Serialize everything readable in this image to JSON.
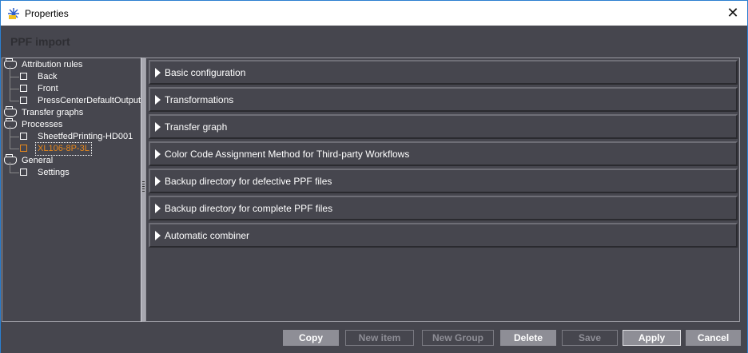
{
  "window": {
    "title": "Properties",
    "close_icon": "close-icon"
  },
  "header": {
    "title": "PPF import"
  },
  "tree": {
    "groups": [
      {
        "label": "Attribution rules",
        "items": [
          "Back",
          "Front",
          "PressCenterDefaultOutput"
        ]
      },
      {
        "label": "Transfer graphs",
        "items": []
      },
      {
        "label": "Processes",
        "items": [
          "SheetfedPrinting-HD001",
          "XL106-8P-3L"
        ]
      },
      {
        "label": "General",
        "items": [
          "Settings"
        ]
      }
    ],
    "selected": "XL106-8P-3L",
    "selected_color": "#e8881c"
  },
  "sections": [
    "Basic configuration",
    "Transformations",
    "Transfer graph",
    "Color Code Assignment Method for Third-party Workflows",
    "Backup directory for defective PPF files",
    "Backup directory for complete PPF files",
    "Automatic combiner"
  ],
  "buttons": [
    {
      "label": "Copy",
      "enabled": true
    },
    {
      "label": "New item",
      "enabled": false
    },
    {
      "label": "New Group",
      "enabled": false
    },
    {
      "label": "Delete",
      "enabled": true
    },
    {
      "label": "Save",
      "enabled": false
    },
    {
      "label": "Apply",
      "enabled": true,
      "primary": true
    },
    {
      "label": "Cancel",
      "enabled": true
    }
  ]
}
